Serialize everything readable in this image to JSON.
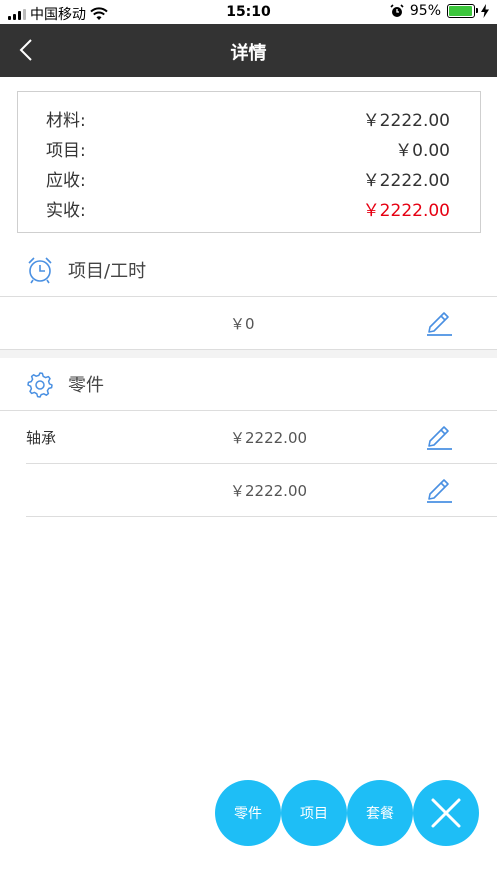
{
  "status_bar": {
    "carrier": "中国移动",
    "time": "15:10",
    "battery": "95%",
    "battery_level": 0.95
  },
  "nav": {
    "title": "详情"
  },
  "summary": {
    "rows": [
      {
        "label": "材料:",
        "value": "￥2222.00"
      },
      {
        "label": "项目:",
        "value": "￥0.00"
      },
      {
        "label": "应收:",
        "value": "￥2222.00"
      },
      {
        "label": "实收:",
        "value": "￥2222.00"
      }
    ],
    "highlight_color": "#e60012"
  },
  "project_section": {
    "title": "项目/工时",
    "items": [
      {
        "name": "",
        "price": "￥0"
      }
    ]
  },
  "parts_section": {
    "title": "零件",
    "items": [
      {
        "name": "轴承",
        "price": "￥2222.00"
      },
      {
        "name": "",
        "price": "￥2222.00"
      }
    ]
  },
  "fabs": {
    "parts": "零件",
    "project": "项目",
    "package": "套餐"
  },
  "colors": {
    "nav_bg": "#333333",
    "accent": "#1ebef6",
    "icon_blue": "#4a90e2"
  }
}
